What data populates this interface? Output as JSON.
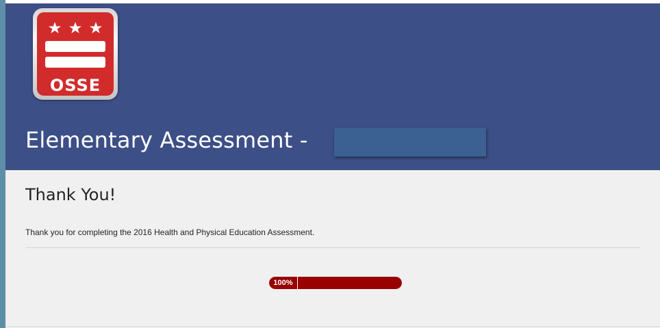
{
  "header": {
    "logo_text": "OSSE",
    "title": "Elementary Assessment -",
    "background_color": "#3d4f87"
  },
  "content": {
    "heading": "Thank You!",
    "message": "Thank you for completing the 2016 Health and Physical Education Assessment."
  },
  "progress": {
    "label": "100%",
    "value": 1.0,
    "fill_color": "#990000"
  }
}
